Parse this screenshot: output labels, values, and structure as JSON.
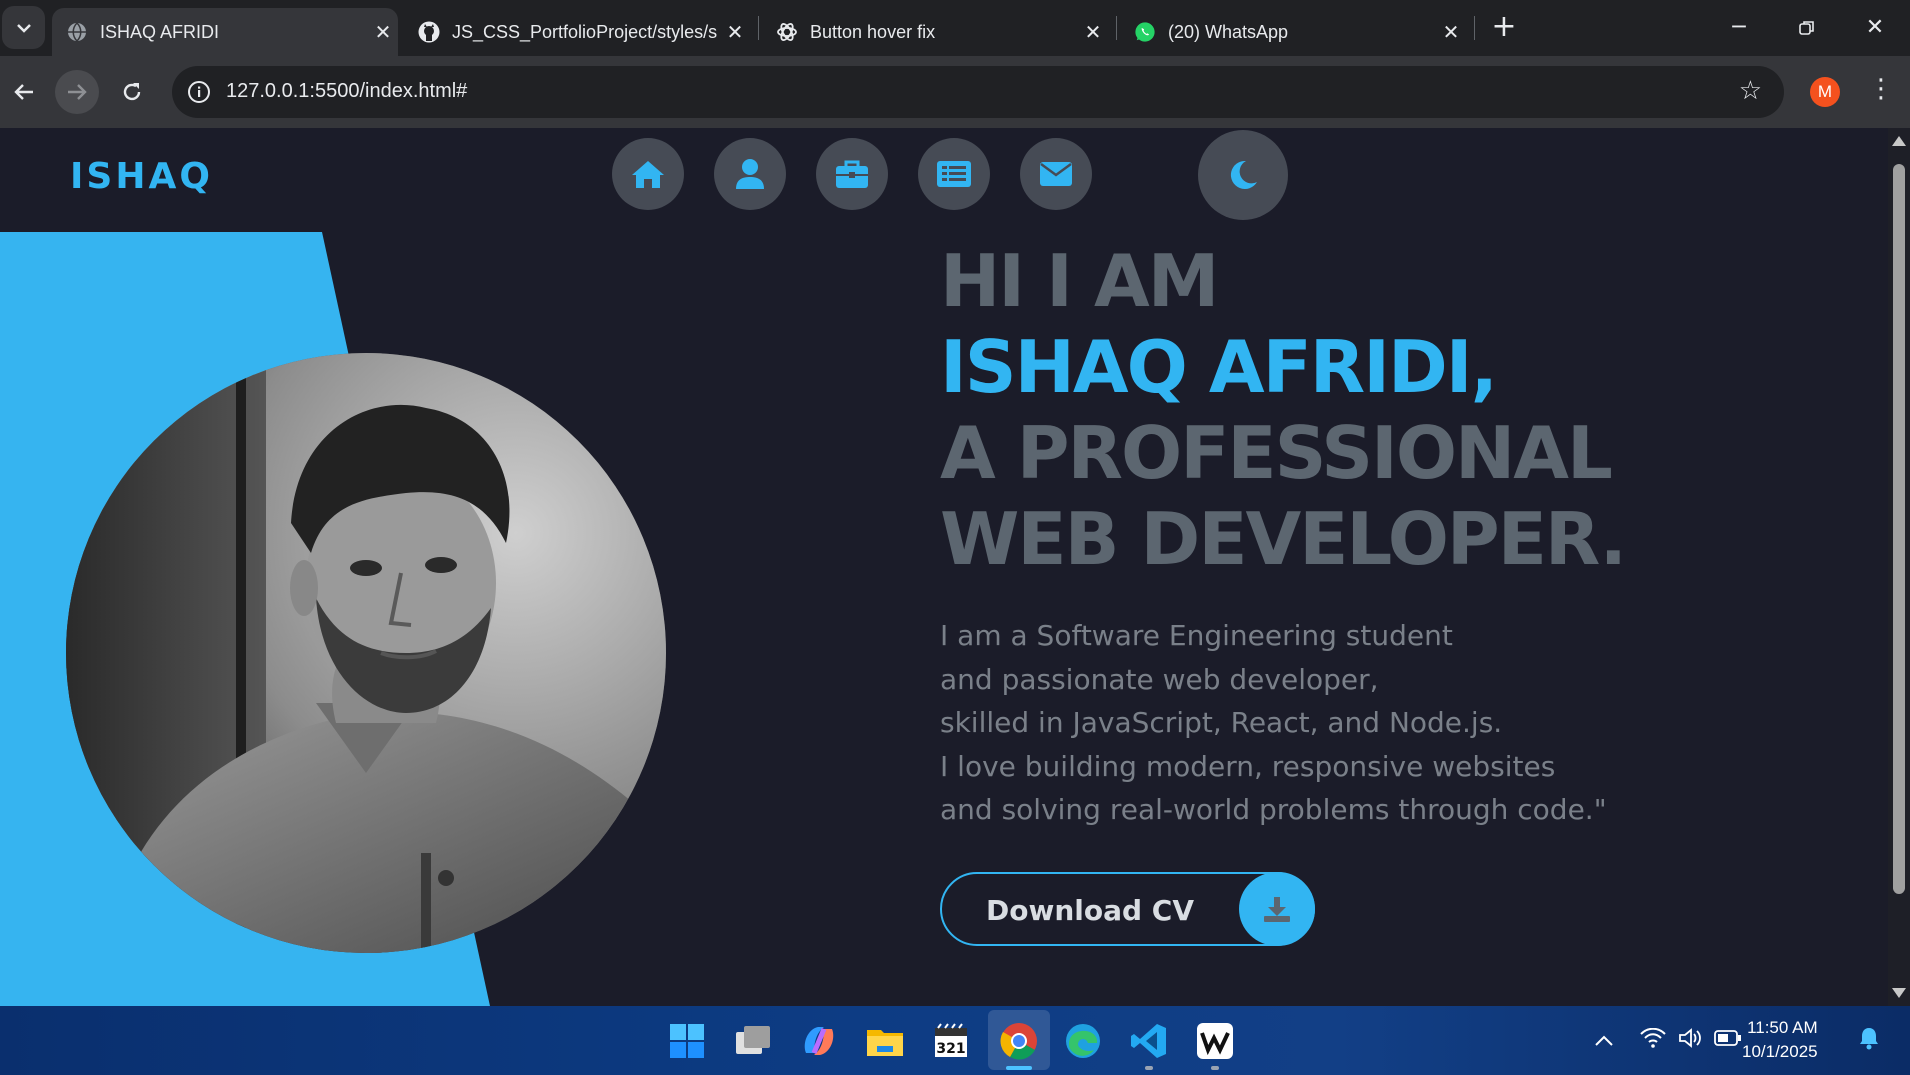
{
  "browser": {
    "tabs": [
      {
        "title": "ISHAQ AFRIDI",
        "active": true,
        "icon": "globe-icon"
      },
      {
        "title": "JS_CSS_PortfolioProject/styles/s",
        "active": false,
        "icon": "github-icon"
      },
      {
        "title": "Button hover fix",
        "active": false,
        "icon": "chatgpt-icon"
      },
      {
        "title": "(20) WhatsApp",
        "active": false,
        "icon": "whatsapp-icon"
      }
    ],
    "url": "127.0.0.1:5500/index.html#",
    "profile_initial": "M"
  },
  "page": {
    "logo": "ISHAQ",
    "nav": [
      "home-icon",
      "user-icon",
      "briefcase-icon",
      "list-icon",
      "envelope-icon"
    ],
    "theme_toggle": "moon-icon",
    "hero": {
      "line1": "HI I AM",
      "line2": "ISHAQ AFRIDI,",
      "line3": "A PROFESSIONAL",
      "line4": "WEB DEVELOPER."
    },
    "description": [
      "I am a Software Engineering student",
      "and passionate web developer,",
      "skilled in JavaScript, React, and Node.js.",
      "I love building modern, responsive websites",
      "and solving real-world problems through code.\""
    ],
    "cta_label": "Download CV"
  },
  "taskbar": {
    "time": "11:50 AM",
    "date": "10/1/2025",
    "apps": [
      "windows-start-icon",
      "task-view-icon",
      "copilot-icon",
      "file-explorer-icon",
      "calendar-icon",
      "chrome-icon",
      "edge-icon",
      "vscode-icon",
      "wps-icon"
    ]
  },
  "colors": {
    "accent": "#32b5f2",
    "page_bg": "#1b1c29",
    "heading_gray": "#5c6670"
  }
}
